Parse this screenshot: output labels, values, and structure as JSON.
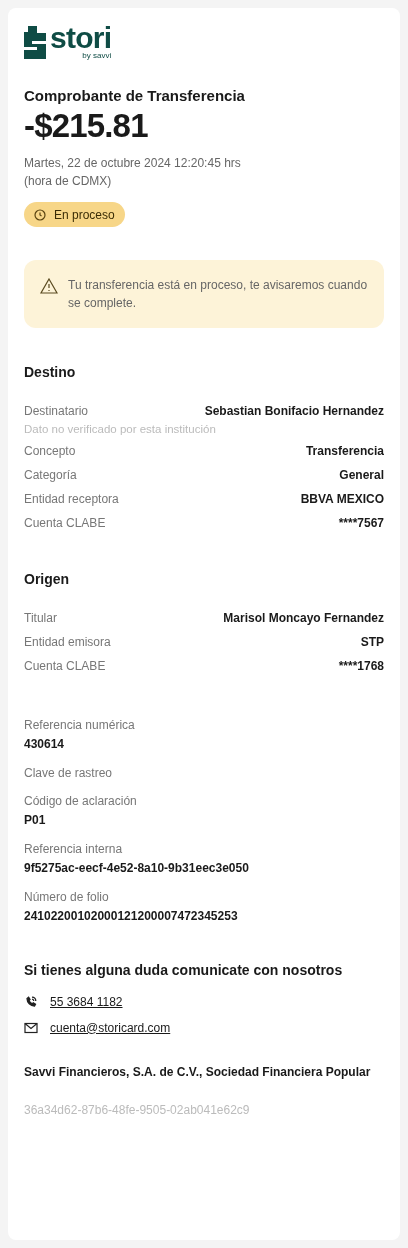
{
  "logo": {
    "wordmark": "stori",
    "tagline": "by savvi"
  },
  "title": "Comprobante de Transferencia",
  "amount": "-$215.81",
  "date": "Martes, 22 de octubre 2024 12:20:45 hrs",
  "timezone": "(hora de CDMX)",
  "status": {
    "kind": "pending",
    "label": "En proceso"
  },
  "alert": {
    "kind": "warning",
    "text": "Tu transferencia está en proceso, te avisaremos cuando se complete."
  },
  "sections": [
    {
      "title": "Destino",
      "rows": [
        {
          "label": "Destinatario",
          "value": "Sebastian Bonifacio Hernandez",
          "note": "Dato no verificado por esta institución"
        },
        {
          "label": "Concepto",
          "value": "Transferencia"
        },
        {
          "label": "Categoría",
          "value": "General"
        },
        {
          "label": "Entidad receptora",
          "value": "BBVA MEXICO"
        },
        {
          "label": "Cuenta CLABE",
          "value": "****7567"
        }
      ]
    },
    {
      "title": "Origen",
      "rows": [
        {
          "label": "Titular",
          "value": "Marisol Moncayo Fernandez"
        },
        {
          "label": "Entidad emisora",
          "value": "STP"
        },
        {
          "label": "Cuenta CLABE",
          "value": "****1768"
        }
      ]
    }
  ],
  "references": [
    {
      "label": "Referencia numérica",
      "value": "430614"
    },
    {
      "label": "Clave de rastreo"
    },
    {
      "label": "Código de aclaración",
      "value": "P01"
    },
    {
      "label": "Referencia interna",
      "value": "9f5275ac-eecf-4e52-8a10-9b31eec3e050"
    },
    {
      "label": "Número de folio",
      "value": "24102200102000121200007472345253"
    }
  ],
  "contact": {
    "title": "Si tienes alguna duda comunicate con nosotros",
    "items": [
      {
        "kind": "phone",
        "text": "55 3684 1182"
      },
      {
        "kind": "email",
        "text": "cuenta@storicard.com"
      }
    ]
  },
  "company": "Savvi Financieros, S.A. de C.V., Sociedad Financiera Popular",
  "receipt_id": "36a34d62-87b6-48fe-9505-02ab041e62c9"
}
